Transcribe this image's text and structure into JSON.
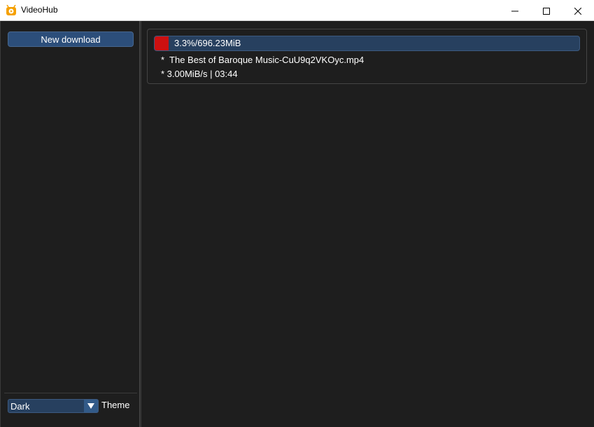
{
  "window": {
    "title": "VideoHub",
    "icon": "videohub-app-icon",
    "controls": [
      "minimize-icon",
      "maximize-icon",
      "close-icon"
    ]
  },
  "sidebar": {
    "new_download_label": "New download",
    "theme": {
      "selected": "Dark",
      "label": "Theme"
    }
  },
  "downloads": [
    {
      "progress_percent": 3.3,
      "progress_text": "3.3%/696.23MiB",
      "filename_line": "*  The Best of Baroque Music-CuU9q2VKOyc.mp4",
      "stats_line": "* 3.00MiB/s | 03:44"
    }
  ],
  "colors": {
    "background": "#1e1e1e",
    "accent": "#2c4e7a",
    "progress_fill": "#cc1010",
    "text": "#ffffff"
  }
}
